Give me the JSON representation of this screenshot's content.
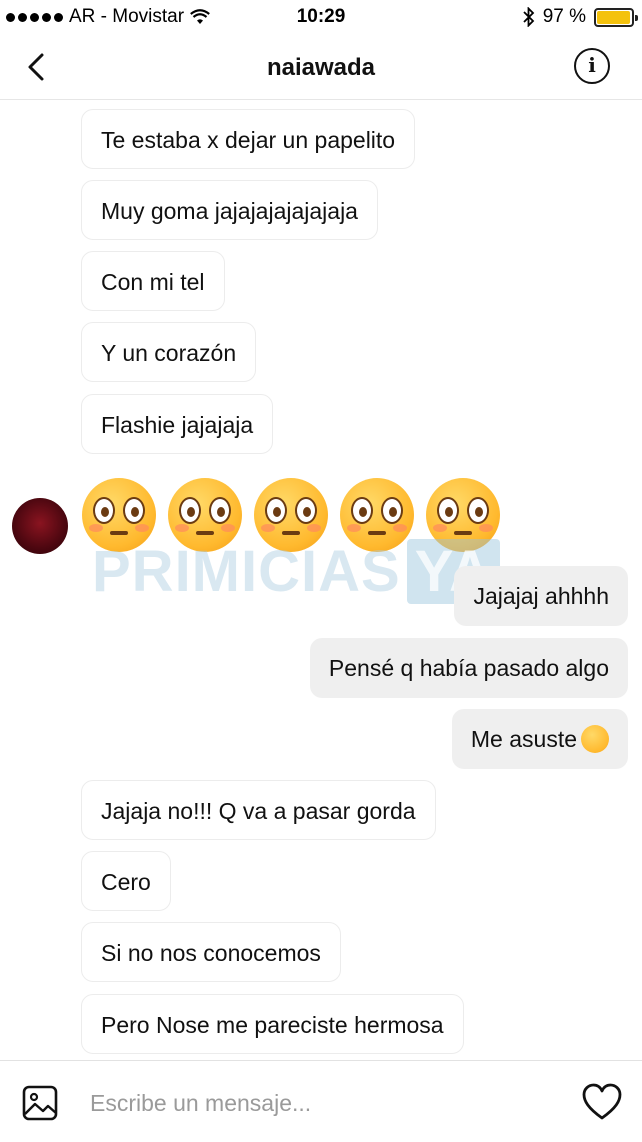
{
  "status_bar": {
    "carrier": "AR - Movistar",
    "time": "10:29",
    "battery": "97 %",
    "battery_level": 0.97
  },
  "header": {
    "title": "naiawada"
  },
  "messages": {
    "incoming_1": "Te estaba x dejar un papelito",
    "incoming_2": "Muy goma jajajajajajajaja",
    "incoming_3": "Con mi tel",
    "incoming_4": "Y un corazón",
    "incoming_5": "Flashie jajajaja",
    "emoji_message": "😳😳😳😳😳",
    "outgoing_1": "Jajajaj ahhhh",
    "outgoing_2": "Pensé q había pasado algo",
    "outgoing_3": "Me asuste",
    "incoming_6": "Jajaja no!!! Q va a pasar gorda",
    "incoming_7": "Cero",
    "incoming_8": "Si no nos conocemos",
    "incoming_9": "Pero Nose me pareciste hermosa"
  },
  "watermark": {
    "text": "PRIMICIAS",
    "badge": "YA"
  },
  "composer": {
    "placeholder": "Escribe un mensaje..."
  },
  "icons": {
    "back": "chevron-left-icon",
    "info": "info-icon",
    "gallery": "image-icon",
    "heart": "heart-icon",
    "wifi": "wifi-icon",
    "bluetooth": "bluetooth-icon",
    "battery": "battery-icon"
  },
  "colors": {
    "incoming_bubble_border": "#ececec",
    "outgoing_bubble_bg": "#efefef",
    "battery_fill": "#f4c20d"
  }
}
